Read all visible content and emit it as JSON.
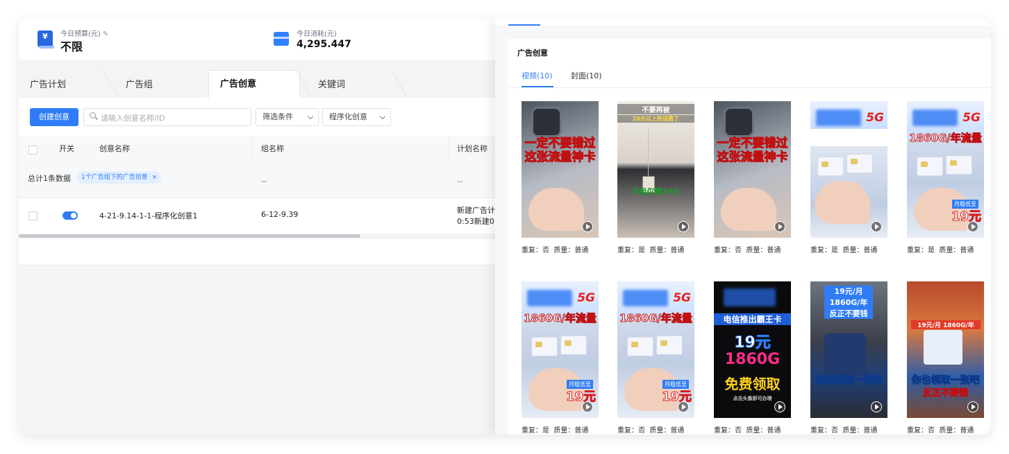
{
  "stats": {
    "budget_label": "今日预算(元)",
    "budget_value": "不限",
    "spend_label": "今日消耗(元)",
    "spend_value": "4,295.447"
  },
  "level_tabs": [
    "广告计划",
    "广告组",
    "广告创意",
    "关键词"
  ],
  "active_tab": "广告创意",
  "toolbar": {
    "create_label": "创建创意",
    "search_placeholder": "请输入创意名称/ID",
    "filter_label": "筛选条件",
    "type_label": "程序化创意"
  },
  "table": {
    "columns": [
      "开关",
      "创意名称",
      "组名称",
      "计划名称"
    ],
    "summary_text": "总计1条数据",
    "summary_chip": "1个广告组下的广告创意",
    "summary_dash_group": "--",
    "summary_dash_plan": "--",
    "rows": [
      {
        "switch_on": true,
        "creative_name": "4-21-9.14-1-1-程序化创意1",
        "group_name": "6-12-9.39",
        "plan_name_line1": "新建广告计",
        "plan_name_line2": "0:53新建0"
      }
    ]
  },
  "creative_panel": {
    "title": "广告创意",
    "tabs": [
      "视频(10)",
      "封面(10)"
    ],
    "active_tab": "视频(10)",
    "dup_label": "重复：",
    "quality_label": "质量：",
    "items": [
      {
        "dup": "否",
        "quality": "普通",
        "overlay_top": "一定不要错过",
        "overlay_bottom": "这张流量神卡",
        "style": "phone"
      },
      {
        "dup": "是",
        "quality": "普通",
        "overlay_top": "不要再被",
        "overlay_sub": "20元以上的话费了",
        "price_text": "月租仅需19元",
        "style": "necklace"
      },
      {
        "dup": "否",
        "quality": "普通",
        "overlay_top": "一定不要错过",
        "overlay_bottom": "这张流量神卡",
        "style": "phone"
      },
      {
        "dup": "是",
        "quality": "普通",
        "g5": "5G",
        "style": "sim"
      },
      {
        "dup": "是",
        "quality": "普通",
        "g5": "5G",
        "overlay_top": "1860G/年流量",
        "price_label": "月租低至",
        "price": "19元",
        "style": "sim2"
      },
      {
        "dup": "是",
        "quality": "普通",
        "g5": "5G",
        "overlay_top": "1860G/年流量",
        "price_label": "月租低至",
        "price": "19元",
        "style": "sim2"
      },
      {
        "dup": "否",
        "quality": "普通",
        "g5": "5G",
        "overlay_top": "1860G/年流量",
        "price_label": "月租低至",
        "price": "19元",
        "style": "sim2"
      },
      {
        "dup": "否",
        "quality": "普通",
        "line1": "电信推出霸王卡",
        "line2": "19元",
        "line3": "1860G",
        "line4": "免费领取",
        "line5": "点击头像即可办理",
        "style": "dark"
      },
      {
        "dup": "否",
        "quality": "普通",
        "top1": "19元/月",
        "top2": "1860G/年",
        "top3": "反正不要钱",
        "bottom1": "你也领取一张吧",
        "style": "card"
      },
      {
        "dup": "否",
        "quality": "普通",
        "top1": "19元/月 1860G/年",
        "bottom1": "你也领取一张吧",
        "bottom2": "反正不要钱",
        "style": "card2"
      }
    ]
  }
}
